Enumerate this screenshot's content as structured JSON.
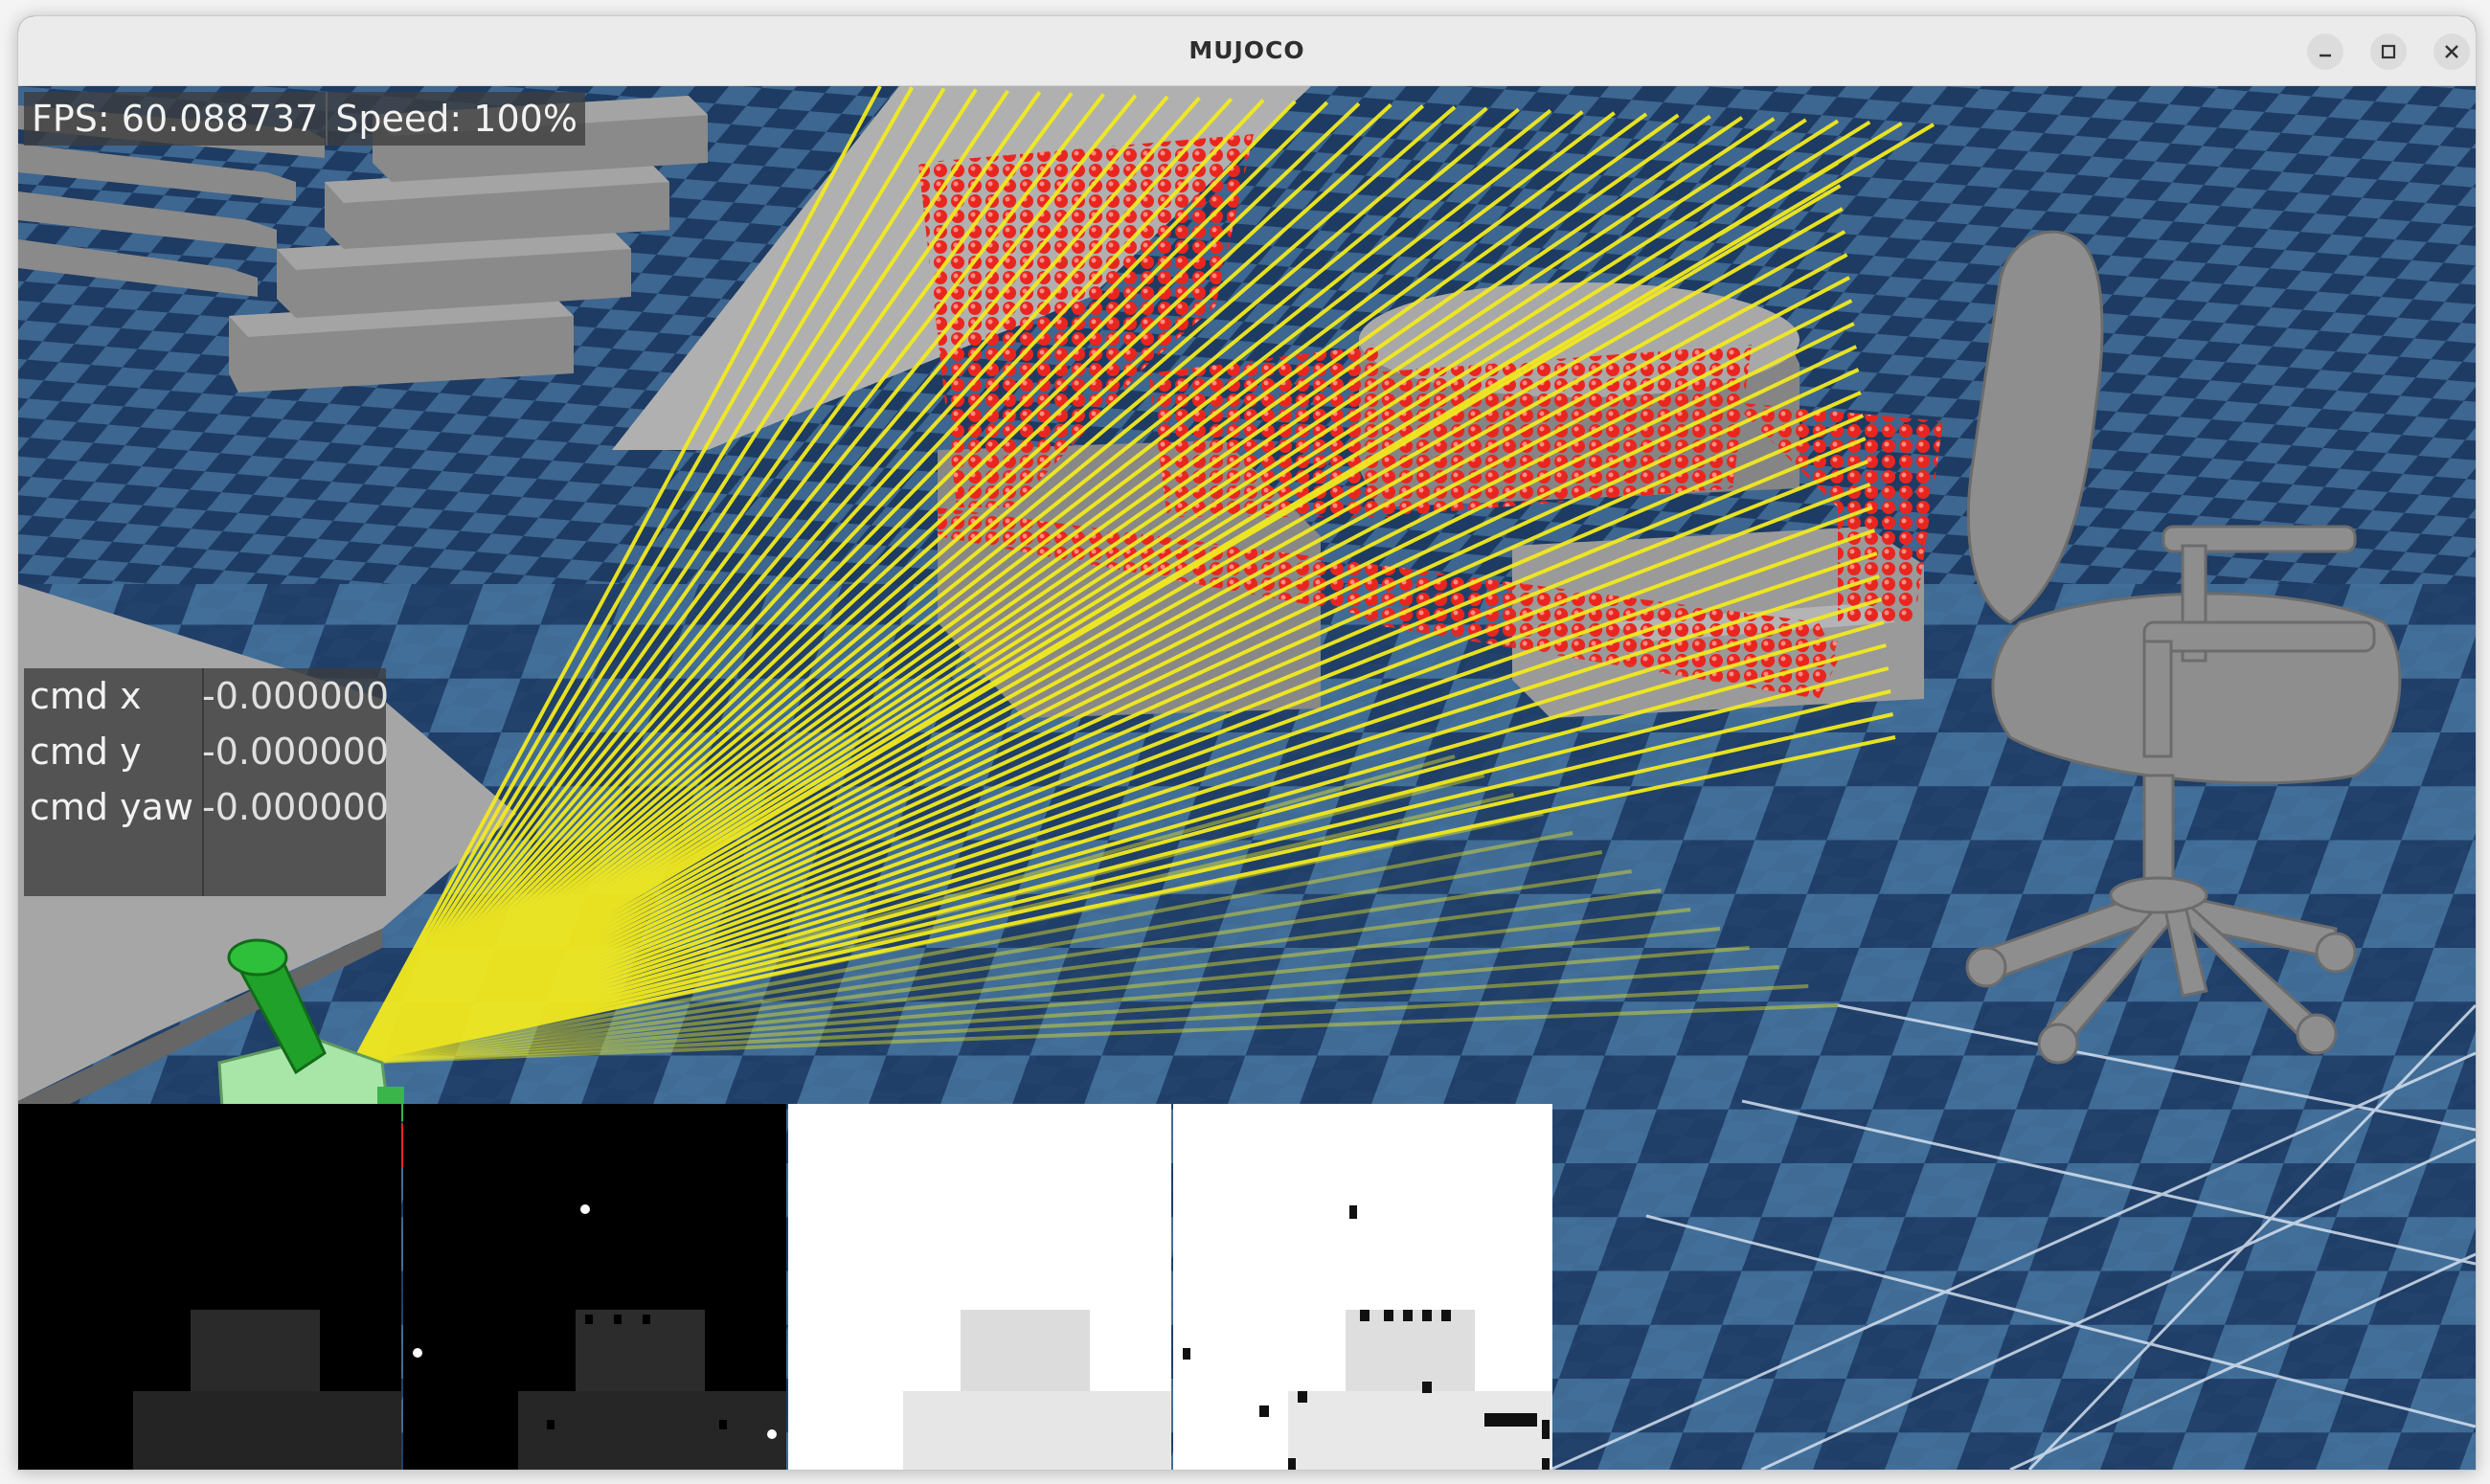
{
  "window": {
    "title": "MUJOCO",
    "controls": [
      "minimize",
      "maximize",
      "close"
    ]
  },
  "hud": {
    "fps_label": "FPS: 60.088737",
    "speed_label": "Speed: 100%"
  },
  "commands": [
    {
      "label": "cmd x",
      "value": "-0.000000"
    },
    {
      "label": "cmd y",
      "value": "-0.000000"
    },
    {
      "label": "cmd yaw",
      "value": "-0.000000"
    }
  ],
  "depth_panels": [
    {
      "name": "raw-depth",
      "background": "#000000",
      "object": "#2a2a2a"
    },
    {
      "name": "noisy-depth",
      "background": "#000000",
      "object": "#2c2c2c"
    },
    {
      "name": "inverted-depth",
      "background": "#ffffff",
      "object": "#dcdcdc"
    },
    {
      "name": "inverted-noisy-depth",
      "background": "#ffffff",
      "object": "#dedede"
    }
  ],
  "colors": {
    "floor_dark": "#1d3b63",
    "floor_light": "#3d6690",
    "lidar_rays": "#f2ea1f",
    "hit_points": "#e8261f",
    "obstacles": "#8c8c8c",
    "robot_body": "#a8e6a8",
    "sensor_mast": "#1fa12a"
  }
}
